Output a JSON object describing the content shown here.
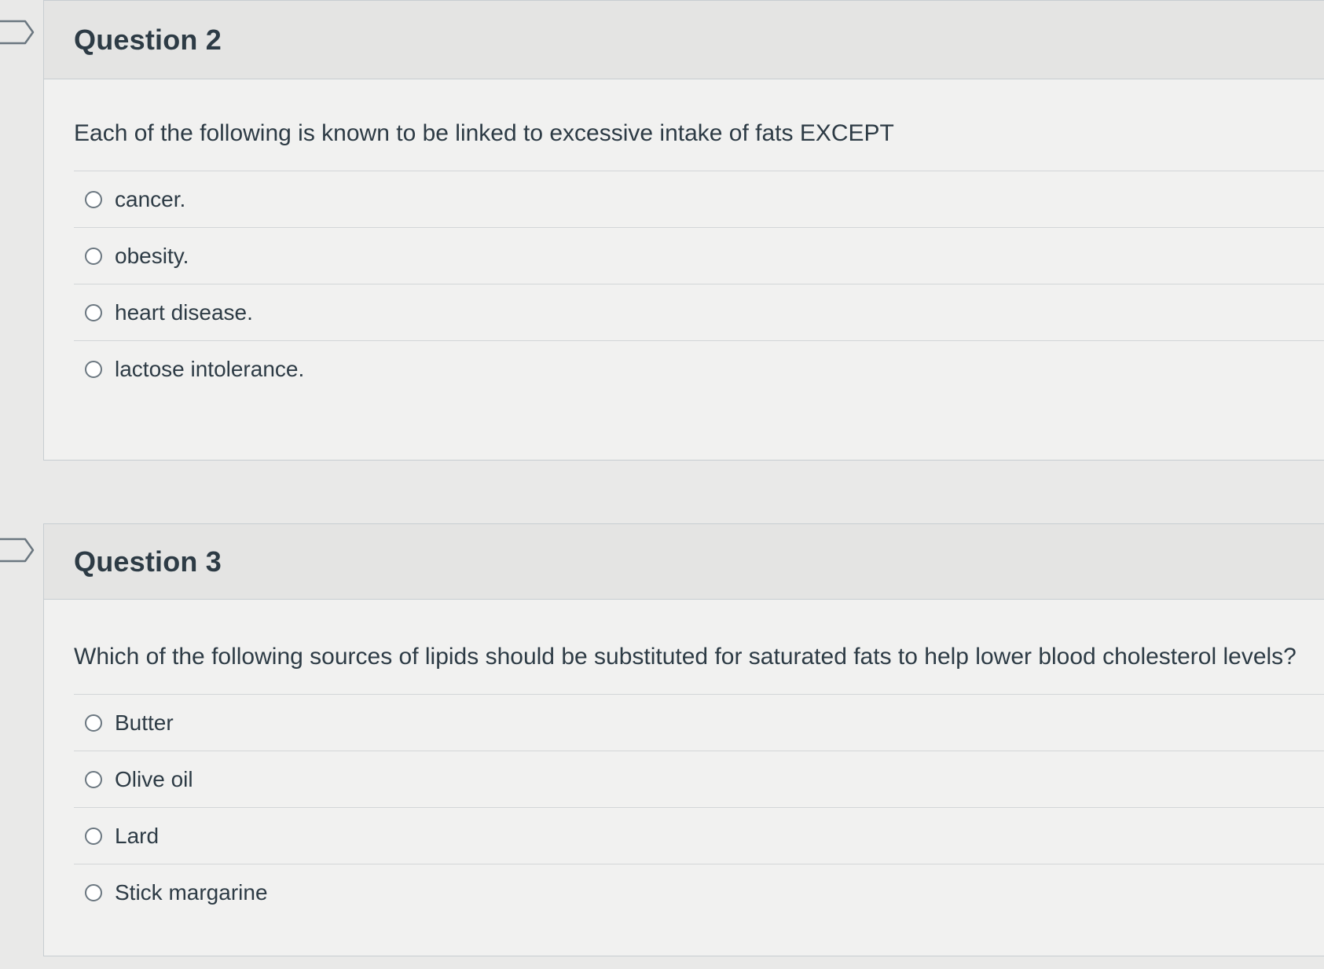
{
  "questions": [
    {
      "title": "Question 2",
      "text": "Each of the following is known to be linked to excessive intake of fats EXCEPT",
      "answers": [
        "cancer.",
        "obesity.",
        "heart disease.",
        "lactose intolerance."
      ]
    },
    {
      "title": "Question 3",
      "text": "Which of the following sources of lipids should be substituted for saturated fats to help lower blood cholesterol levels?",
      "answers": [
        "Butter",
        "Olive oil",
        "Lard",
        "Stick margarine"
      ]
    }
  ],
  "icons": {
    "flag": "bookmark-flag-icon",
    "radio": "radio-button-icon"
  },
  "colors": {
    "text": "#2d3b45",
    "header_bg": "#e4e4e3",
    "body_bg": "#f1f1f0",
    "border": "#c7cdd1"
  }
}
